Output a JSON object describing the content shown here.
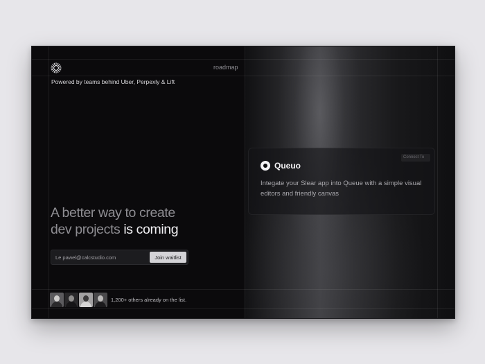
{
  "header": {
    "nav_roadmap": "roadmap",
    "powered_by": "Powered by teams behind Uber, Perpexly & Lift"
  },
  "hero": {
    "headline_line1": "A better way to create",
    "headline_line2_dim": "dev projects",
    "headline_line2_strong": "is coming"
  },
  "waitlist": {
    "email_value": "Le pawel@calcstudio.com",
    "button_label": "Join waitlist"
  },
  "social_proof": {
    "text": "1,200+ others already on the list."
  },
  "preview_card": {
    "title": "Queuo",
    "description": "Integate your Slear app into Queue with a simple visual editors and friendly canvas",
    "chip_label": "Connect To"
  },
  "colors": {
    "page_background": "#e7e6ea",
    "frame_background": "#0b0a0c",
    "text_strong": "#f1f0f3",
    "text_dim": "#8e8d92",
    "button_background": "#d4d3d7"
  },
  "icons": {
    "logo": "sunburst-ring-logo-icon",
    "card_logo": "ring-dot-logo-icon"
  }
}
